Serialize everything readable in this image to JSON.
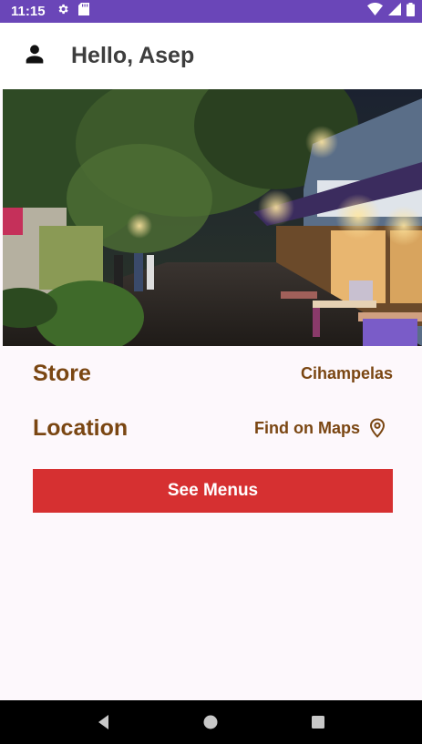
{
  "status_bar": {
    "time": "11:15",
    "left_icons": [
      "settings-icon",
      "sd-card-icon"
    ],
    "right_icons": [
      "wifi-icon",
      "signal-icon",
      "battery-icon"
    ]
  },
  "header": {
    "avatar_icon": "person-icon",
    "greeting": "Hello, Asep"
  },
  "hero": {
    "subject": "store-photo"
  },
  "store_row": {
    "label": "Store",
    "value": "Cihampelas"
  },
  "location_row": {
    "label": "Location",
    "link_text": "Find on Maps",
    "icon": "map-pin-icon"
  },
  "actions": {
    "see_menus_label": "See Menus"
  },
  "nav_bar": {
    "buttons": [
      "back-icon",
      "home-icon",
      "recents-icon"
    ]
  },
  "colors": {
    "status_bar": "#6a46b8",
    "accent_brown": "#7a4612",
    "button_red": "#d63031",
    "background": "#fdf8fc"
  }
}
